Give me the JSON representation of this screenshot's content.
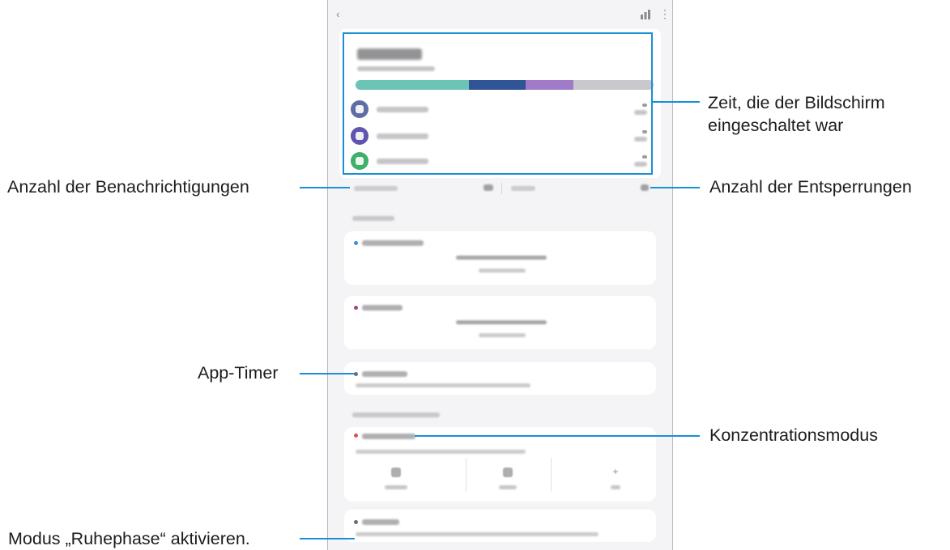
{
  "callouts": {
    "screen_time": "Zeit, die der Bildschirm",
    "screen_time_line2": "eingeschaltet war",
    "notifications": "Anzahl der Benachrichtigungen",
    "unlocks": "Anzahl der Entsperrungen",
    "app_timer": "App-Timer",
    "focus_mode": "Konzentrationsmodus",
    "bedtime": "Modus „Ruhephase“ aktivieren."
  },
  "colors": {
    "highlight": "#1a8fd6",
    "app_teal": "#6cc4b6",
    "app_navy": "#2f5597",
    "app_purple": "#a07cc8",
    "app_remaining": "#c9c9cd",
    "app1_icon": "#5c6ea4",
    "app2_icon": "#5f54b0",
    "app3_icon": "#3fb06a",
    "focus_dot": "#d9534f",
    "goal_dot_1": "#3a8fd8",
    "goal_dot_2": "#a04a7c"
  },
  "usage_bar": {
    "segments": [
      {
        "color_key": "app_teal",
        "share": 0.38
      },
      {
        "color_key": "app_navy",
        "share": 0.19
      },
      {
        "color_key": "app_purple",
        "share": 0.16
      },
      {
        "color_key": "app_remaining",
        "share": 0.27
      }
    ]
  },
  "icons": {
    "back": "back-arrow-icon",
    "chart": "chart-icon",
    "more": "more-options-icon",
    "app1": "settings-app-icon",
    "app2": "messages-app-icon",
    "app3": "phone-app-icon"
  }
}
